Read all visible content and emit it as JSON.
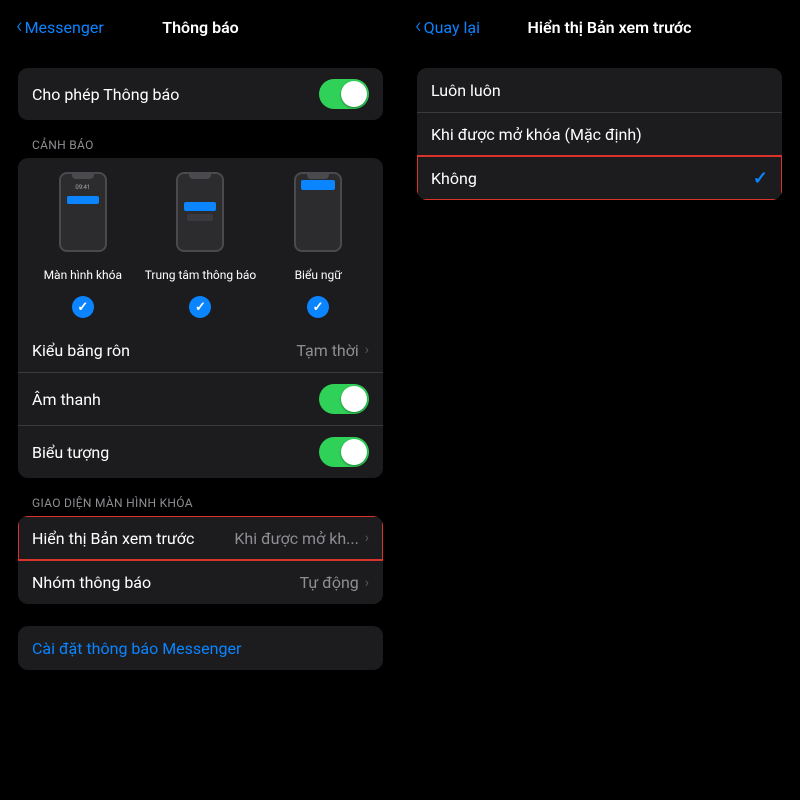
{
  "left": {
    "back": "Messenger",
    "title": "Thông báo",
    "allow_label": "Cho phép Thông báo",
    "allow_on": true,
    "alerts_header": "CẢNH BÁO",
    "alerts": {
      "lock_time": "09:41",
      "opt_lock": "Màn hình khóa",
      "opt_nc": "Trung tâm thông báo",
      "opt_banner": "Biểu ngữ"
    },
    "banner_style": {
      "label": "Kiểu băng rôn",
      "value": "Tạm thời"
    },
    "sounds": {
      "label": "Âm thanh",
      "on": true
    },
    "badges": {
      "label": "Biểu tượng",
      "on": true
    },
    "lock_header": "GIAO DIỆN MÀN HÌNH KHÓA",
    "show_preview": {
      "label": "Hiển thị Bản xem trước",
      "value": "Khi được mở kh..."
    },
    "grouping": {
      "label": "Nhóm thông báo",
      "value": "Tự động"
    },
    "messenger_link": "Cài đặt thông báo Messenger"
  },
  "right": {
    "back": "Quay lại",
    "title": "Hiển thị Bản xem trước",
    "options": [
      {
        "label": "Luôn luôn",
        "selected": false
      },
      {
        "label": "Khi được mở khóa (Mặc định)",
        "selected": false
      },
      {
        "label": "Không",
        "selected": true
      }
    ]
  }
}
